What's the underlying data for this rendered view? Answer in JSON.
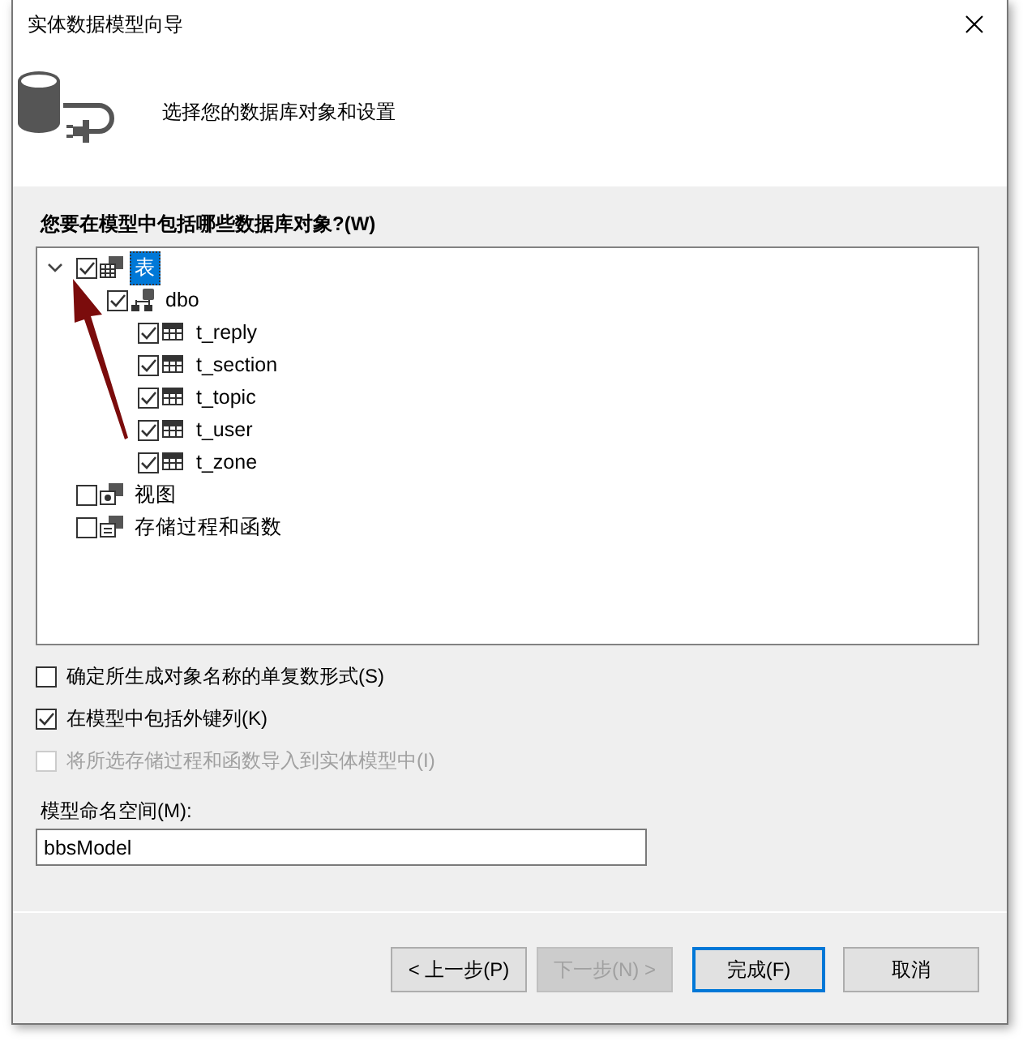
{
  "window": {
    "title": "实体数据模型向导"
  },
  "header": {
    "text": "选择您的数据库对象和设置"
  },
  "question": "您要在模型中包括哪些数据库对象?(W)",
  "tree": [
    {
      "label": "表",
      "kind": "tables",
      "checked": true,
      "expanded": true,
      "selected": true,
      "children": [
        {
          "label": "dbo",
          "kind": "schema",
          "checked": true,
          "expanded": true,
          "selected": false,
          "children": [
            {
              "label": "t_reply",
              "kind": "table",
              "checked": true,
              "selected": false
            },
            {
              "label": "t_section",
              "kind": "table",
              "checked": true,
              "selected": false
            },
            {
              "label": "t_topic",
              "kind": "table",
              "checked": true,
              "selected": false
            },
            {
              "label": "t_user",
              "kind": "table",
              "checked": true,
              "selected": false
            },
            {
              "label": "t_zone",
              "kind": "table",
              "checked": true,
              "selected": false
            }
          ]
        }
      ]
    },
    {
      "label": "视图",
      "kind": "views",
      "checked": false,
      "selected": false
    },
    {
      "label": "存储过程和函数",
      "kind": "procedures",
      "checked": false,
      "selected": false
    }
  ],
  "options": [
    {
      "label": "确定所生成对象名称的单复数形式(S)",
      "checked": false,
      "disabled": false
    },
    {
      "label": "在模型中包括外键列(K)",
      "checked": true,
      "disabled": false
    },
    {
      "label": "将所选存储过程和函数导入到实体模型中(I)",
      "checked": false,
      "disabled": true
    }
  ],
  "namespace": {
    "label": "模型命名空间(M):",
    "value": "bbsModel"
  },
  "buttons": [
    {
      "label": "< 上一步(P)",
      "disabled": false,
      "default": false
    },
    {
      "label": "下一步(N) >",
      "disabled": true,
      "default": false
    },
    {
      "label": "完成(F)",
      "disabled": false,
      "default": true
    },
    {
      "label": "取消",
      "disabled": false,
      "default": false
    }
  ]
}
